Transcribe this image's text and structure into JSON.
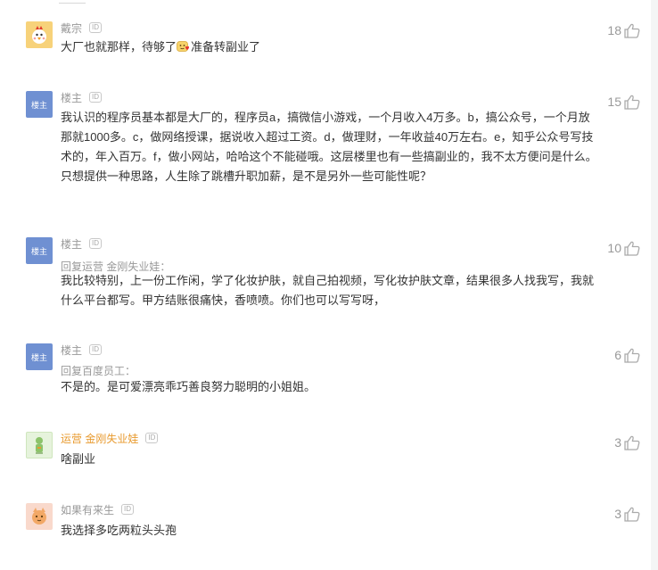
{
  "comments": [
    {
      "name": "戴宗",
      "id_tag": "ID",
      "avatar": "chicken-avatar",
      "text_before": "大厂也就那样，待够了",
      "emoji": "shy-emoji",
      "text_after": "准备转副业了",
      "likes": "18"
    },
    {
      "name": "楼主",
      "id_tag": "ID",
      "avatar_label": "楼主",
      "text": "我认识的程序员基本都是大厂的，程序员a，搞微信小游戏，一个月收入4万多。b，搞公众号，一个月放那就1000多。c，做网络授课，据说收入超过工资。d，做理财，一年收益40万左右。e，知乎公众号写技术的，年入百万。f，做小网站，哈哈这个不能碰哦。这层楼里也有一些搞副业的，我不太方便问是什么。只想提供一种思路，人生除了跳槽升职加薪，是不是另外一些可能性呢？",
      "likes": "15"
    },
    {
      "name": "楼主",
      "id_tag": "ID",
      "avatar_label": "楼主",
      "reply_to": "回复运营 金刚失业娃：",
      "text": "我比较特别，上一份工作闲，学了化妆护肤，就自己拍视频，写化妆护肤文章，结果很多人找我写，我就什么平台都写。甲方结账很痛快，香喷喷。你们也可以写写呀，",
      "likes": "10"
    },
    {
      "name": "楼主",
      "id_tag": "ID",
      "avatar_label": "楼主",
      "reply_to": "回复百度员工：",
      "text": "不是的。是可爱漂亮乖巧善良努力聪明的小姐姐。",
      "likes": "6"
    },
    {
      "name": "运营 金刚失业娃",
      "id_tag": "ID",
      "avatar": "green-figure-avatar",
      "text": "啥副业",
      "likes": "3"
    },
    {
      "name": "如果有来生",
      "id_tag": "ID",
      "avatar": "orange-cat-avatar",
      "text": "我选择多吃两粒头头孢",
      "likes": "3"
    }
  ],
  "colors": {
    "op_name": "#e89a2e",
    "louzhu_avatar": "#6f90d2",
    "meta_text": "#999999",
    "body_text": "#333333"
  }
}
